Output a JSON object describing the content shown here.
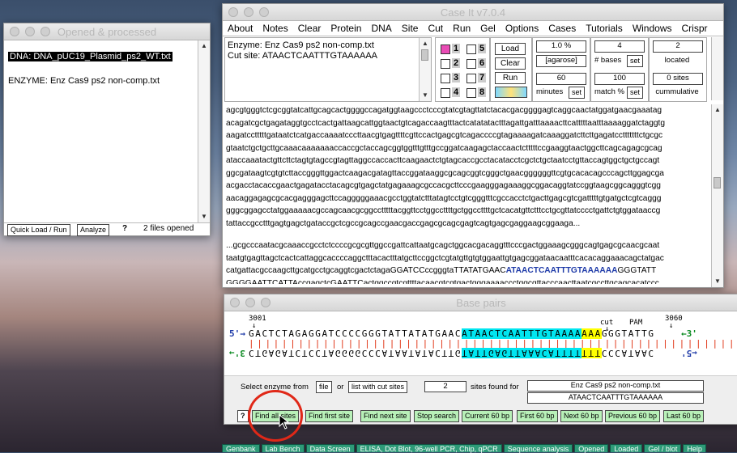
{
  "left_window": {
    "title": "Opened & processed",
    "dna_line": "DNA: DNA_pUC19_Plasmid_ps2_WT.txt",
    "enzyme_line": "ENZYME: Enz Cas9 ps2 non-comp.txt",
    "quick_load": "Quick Load / Run",
    "analyze": "Analyze",
    "help": "?",
    "files_opened": "2  files opened"
  },
  "main_window": {
    "title": "Case It v7.0.4",
    "menu": [
      "About",
      "Notes",
      "Clear",
      "Protein",
      "DNA",
      "Site",
      "Cut",
      "Run",
      "Gel",
      "Options",
      "Cases",
      "Tutorials",
      "Windows",
      "Crispr"
    ],
    "info_enzyme": "Enzyme: Enz Cas9 ps2 non-comp.txt",
    "info_cutsite": "Cut site:  ATAACTCAATTTGTAAAAAA",
    "lanes": [
      "1",
      "2",
      "3",
      "4",
      "5",
      "6",
      "7",
      "8"
    ],
    "load": "Load",
    "clear": "Clear",
    "run": "Run",
    "agarose_value": "1.0  %",
    "agarose_label": "[agarose]",
    "minutes_value": "60",
    "minutes_label": "minutes",
    "set": "set",
    "bases_value": "4",
    "bases_label": "# bases",
    "match_value": "100",
    "match_label": "match %",
    "located_value": "2",
    "located_label": "located",
    "sites_value": "0  sites",
    "cumulative_label": "cummulative",
    "seq_block1": [
      "agcgtgggtctcgcggtatcattgcagcactggggccagatggtaagccctcccgtatcgtagttatctacacgacggggagtcaggcaactatggatgaacgaaatag",
      "acagatcgctgagataggtgcctcactgattaagcattggtaactgtcagaccaagtttactcatatatactttagattgatttaaaacttcatttttaatttaaaaggatctaggtg",
      "aagatcctttttgataatctcatgaccaaaatcccttaacgtgagttttcgttccactgagcgtcagaccccgtagaaaagatcaaaggatcttcttgagatcctttttttctgcgc",
      "gtaatctgctgcttgcaaacaaaaaaaccaccgctaccagcggtggtttgtttgccggatcaagagctaccaactctttttccgaaggtaactggcttcagcagagcgcag",
      "ataccaaatactgttcttctagtgtagccgtagttaggccaccacttcaagaactctgtagcaccgcctacatacctcgctctgctaatcctgttaccagtggctgctgccagt",
      "ggcgataagtcgtgtcttaccgggttggactcaagacgatagttaccggataaggcgcagcggtcgggctgaacggggggttcgtgcacacagcccagcttggagcga",
      "acgacctacaccgaactgagatacctacagcgtgagctatgagaaagcgccacgcttcccgaagggagaaaggcggacaggtatccggtaagcggcagggtcgg",
      "aacaggagagcgcacgagggagcttccagggggaaacgcctggtatctttatagtcctgtcgggtttcgccacctctgacttgagcgtcgatttttgtgatgctcgtcaggg",
      "gggcggagcctatggaaaaacgccagcaacgcggcctttttacggttcctggccttttgctggccttttgctcacatgttctttcctgcgttatcccctgattctgtggataaccg",
      "tattaccgcctttgagtgagctgataccgctcgccgcagccgaacgaccgagcgcagcgagtcagtgagcgaggaagcggaaga..."
    ],
    "seq_block2": [
      "...gcgcccaatacgcaaaccgcctctccccgcgcgttggccgattcattaatgcagctggcacgacaggtttcccgactggaaagcgggcagtgagcgcaacgcaat",
      "taatgtgagttagctcactcattaggcaccccaggctttacactttatgcttccggctcgtatgttgtgtggaattgtgagcggataacaatttcacacaggaaacagctatgac",
      "catgattacgccaagcttgcatgcctgcaggtcgactctagaGGATCCccgggtaTTATATGAAC",
      "GGGGAATTCATTAccgagctcGAATTCactggccgtcgttttacaacgtcgtgactgggaaaaccctggcgttacccaacttaatcgccttgcagcacatccc",
      "cctttcgccagctggcgtaatagcgaagaggcccgcaccgatcgcccttcccaacagttgcgcagcctgaatggcgaatggcgcctgatgcggtattttctccttacgca"
    ],
    "seq_highlight": "ATAACTCAATTTGTAAAAAA",
    "seq_after_highlight": "GGGTATT"
  },
  "bp_window": {
    "title": "Base pairs",
    "pos_start": "3001",
    "pos_end": "3060",
    "cut_label": "cut",
    "pam_label": "PAM",
    "five_prime": "5'",
    "three_prime": "3'",
    "top_pre": "GACTCTAGAGGATCCCCGGGTATTATATGAAC",
    "top_hl": "ATAACTCAATTTGTAAAA",
    "top_pam": "AAA",
    "top_post": "GGGTATTG",
    "bot_pre": "CTGAGATCTCCTAGGGGCCCATAATATACTTG",
    "bot_hl": "TATTGAGTTAAACATTTT",
    "bot_pam": "TTT",
    "bot_post": "CCCATAAC",
    "select_label": "Select enzyme from",
    "file_btn": "file",
    "or": "or",
    "list_btn": "list with cut sites",
    "sites_count": "2",
    "sites_found": "sites found for",
    "enzyme_name": "Enz Cas9 ps2 non-comp.txt",
    "enzyme_seq": "ATAACTCAATTTGTAAAAAA",
    "help": "?",
    "buttons": [
      "Find all sites",
      "Find first site",
      "Find next site",
      "Stop search",
      "Current 60 bp",
      "First 60 bp",
      "Next 60 bp",
      "Previous 60 bp",
      "Last 60 bp"
    ]
  },
  "taskbar": [
    "Genbank",
    "Lab Bench",
    "Data Screen",
    "ELISA, Dot Blot, 96-well PCR, Chip, qPCR",
    "Sequence analysis",
    "Opened",
    "Loaded",
    "Gel / blot",
    "Help"
  ],
  "colors": {
    "highlight_cyan": "#00e6f0",
    "pam_yellow": "#ffff00",
    "mismatch_red": "#e03010",
    "arrow_blue": "#1e3aa8",
    "arrow_green": "#0a8a20",
    "focus_ring": "#e02818",
    "taskbar_green": "#2e9b78"
  }
}
